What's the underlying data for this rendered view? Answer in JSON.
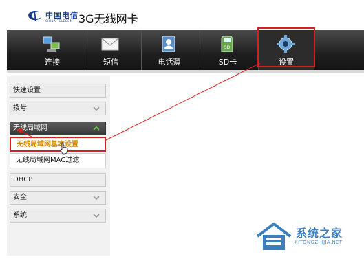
{
  "header": {
    "brand_cn": "中国电信",
    "brand_en": "CHINA TELECOM",
    "product_title": "3G无线网卡"
  },
  "toolbar": {
    "tabs": [
      {
        "label": "连接",
        "icon": "connect-icon"
      },
      {
        "label": "短信",
        "icon": "envelope-icon"
      },
      {
        "label": "电话薄",
        "icon": "contacts-icon"
      },
      {
        "label": "SD卡",
        "icon": "sd-card-icon"
      },
      {
        "label": "设置",
        "icon": "gear-icon"
      }
    ],
    "active_tab": "设置"
  },
  "sidebar": {
    "items": [
      {
        "label": "快速设置"
      },
      {
        "label": "拨号"
      },
      {
        "label": "无线局域网"
      },
      {
        "label": "无线局域网基本设置"
      },
      {
        "label": "无线局域网MAC过滤"
      },
      {
        "label": "DHCP"
      },
      {
        "label": "安全"
      },
      {
        "label": "系统"
      }
    ]
  },
  "watermark": {
    "text": "系统之家",
    "url": "XITONGZHIJIA.NET"
  },
  "colors": {
    "highlight": "#d62020",
    "selected_text": "#d88a00",
    "toolbar_bg": "#1f1f1f"
  }
}
